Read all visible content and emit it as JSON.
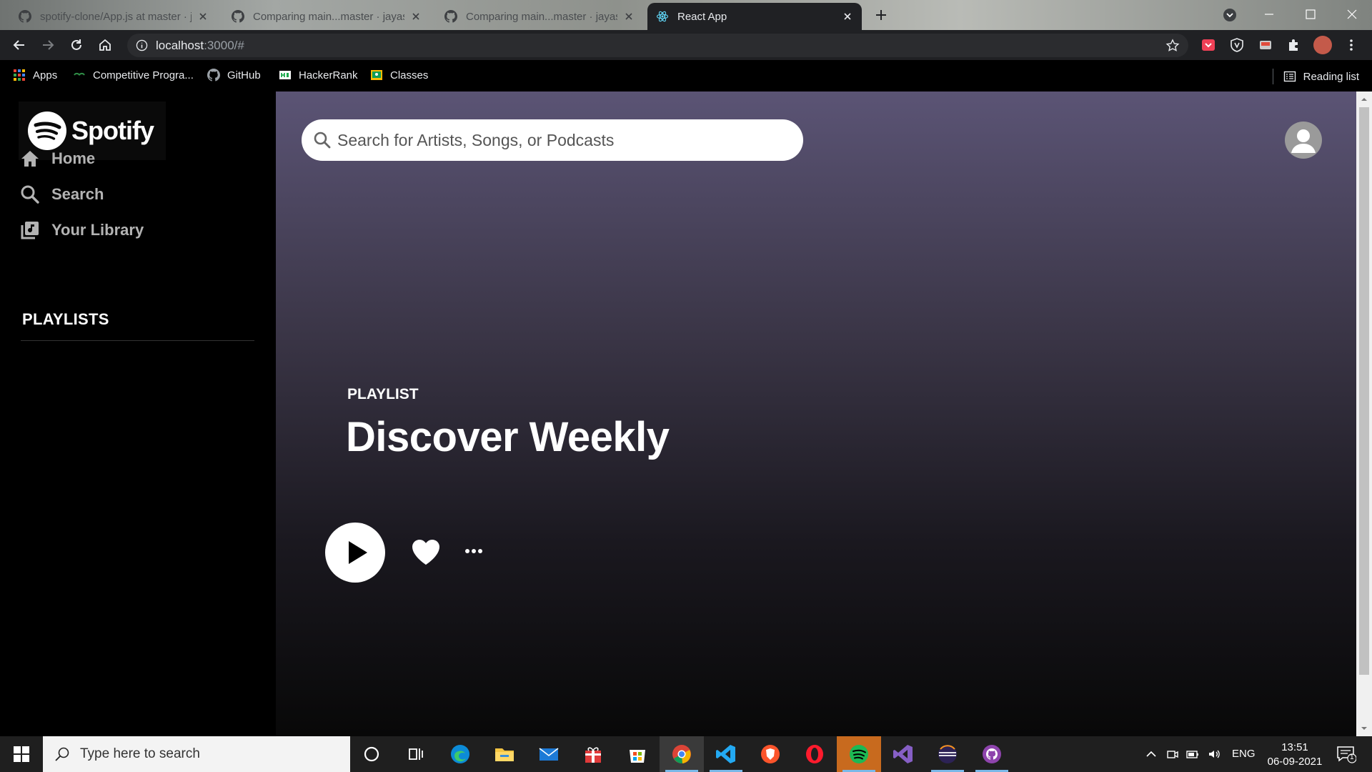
{
  "browser": {
    "tabs": [
      {
        "title": "spotify-clone/App.js at master · jayas...",
        "active": false
      },
      {
        "title": "Comparing main...master · jayas...",
        "active": false
      },
      {
        "title": "Comparing main...master · jayas...",
        "active": false
      },
      {
        "title": "React App",
        "active": true
      }
    ],
    "url": {
      "host": "localhost",
      "rest": ":3000/#"
    },
    "bookmarks": [
      {
        "label": "Apps",
        "icon": "apps-grid-icon"
      },
      {
        "label": "Competitive Progra...",
        "icon": "gfg-icon"
      },
      {
        "label": "GitHub",
        "icon": "github-icon"
      },
      {
        "label": "HackerRank",
        "icon": "hackerrank-icon"
      },
      {
        "label": "Classes",
        "icon": "classroom-icon"
      }
    ],
    "reading_list": "Reading list"
  },
  "sidebar": {
    "logo_text": "Spotify",
    "nav": [
      {
        "label": "Home",
        "icon": "home-icon"
      },
      {
        "label": "Search",
        "icon": "search-icon"
      },
      {
        "label": "Your Library",
        "icon": "library-icon"
      }
    ],
    "playlists_title": "PLAYLISTS"
  },
  "header": {
    "search_placeholder": "Search for Artists, Songs, or Podcasts"
  },
  "body": {
    "type_label": "PLAYLIST",
    "title": "Discover Weekly"
  },
  "taskbar": {
    "search_placeholder": "Type here to search",
    "language": "ENG",
    "time": "13:51",
    "date": "06-09-2021",
    "notification_count": "1"
  },
  "colors": {
    "spotify_green": "#1db954",
    "main_gradient_top": "#5b5475",
    "sidebar_bg": "#000000",
    "nav_text": "#b3b3b3"
  }
}
